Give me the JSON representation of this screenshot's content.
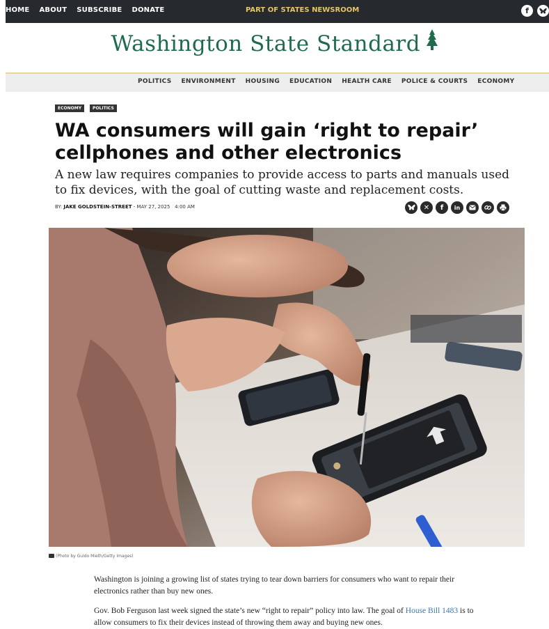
{
  "topbar": {
    "nav": [
      "HOME",
      "ABOUT",
      "SUBSCRIBE",
      "DONATE"
    ],
    "center_label": "PART OF STATES NEWSROOM",
    "social_icons": [
      "facebook-icon",
      "bluesky-icon"
    ]
  },
  "logo": {
    "name": "Washington State Standard",
    "color": "#1e6b4d"
  },
  "section_nav": [
    "POLITICS",
    "ENVIRONMENT",
    "HOUSING",
    "EDUCATION",
    "HEALTH CARE",
    "POLICE & COURTS",
    "ECONOMY"
  ],
  "article": {
    "tags": [
      "ECONOMY",
      "POLITICS"
    ],
    "headline": "WA consumers will gain ‘right to repair’ cellphones and other electronics",
    "subheadline": "A new law requires companies to provide access to parts and manuals used to fix devices, with the goal of cutting waste and replacement costs.",
    "byline_prefix": "BY:",
    "author": "JAKE GOLDSTEIN-STREET",
    "date": "- MAY 27, 2025",
    "time": "4:00 AM",
    "share_icons": [
      "bluesky-icon",
      "x-icon",
      "facebook-icon",
      "linkedin-icon",
      "email-icon",
      "link-icon",
      "print-icon"
    ],
    "photo_caption": "(Photo by Guido Mieth/Getty Images)",
    "paragraphs": {
      "p1": "Washington is joining a growing list of states trying to tear down barriers for consumers who want to repair their electronics rather than buy new ones.",
      "p2_before": "Gov. Bob Ferguson last week signed the state’s new “right to repair” policy into law. The goal of ",
      "p2_link": "House Bill 1483",
      "p2_after": " is to allow consumers to fix their devices instead of throwing them away and buying new ones."
    }
  },
  "colors": {
    "topbar": "#262a2f",
    "accent_gold": "#e7c566",
    "brand_green": "#1e6b4d",
    "link": "#3a78b5"
  }
}
